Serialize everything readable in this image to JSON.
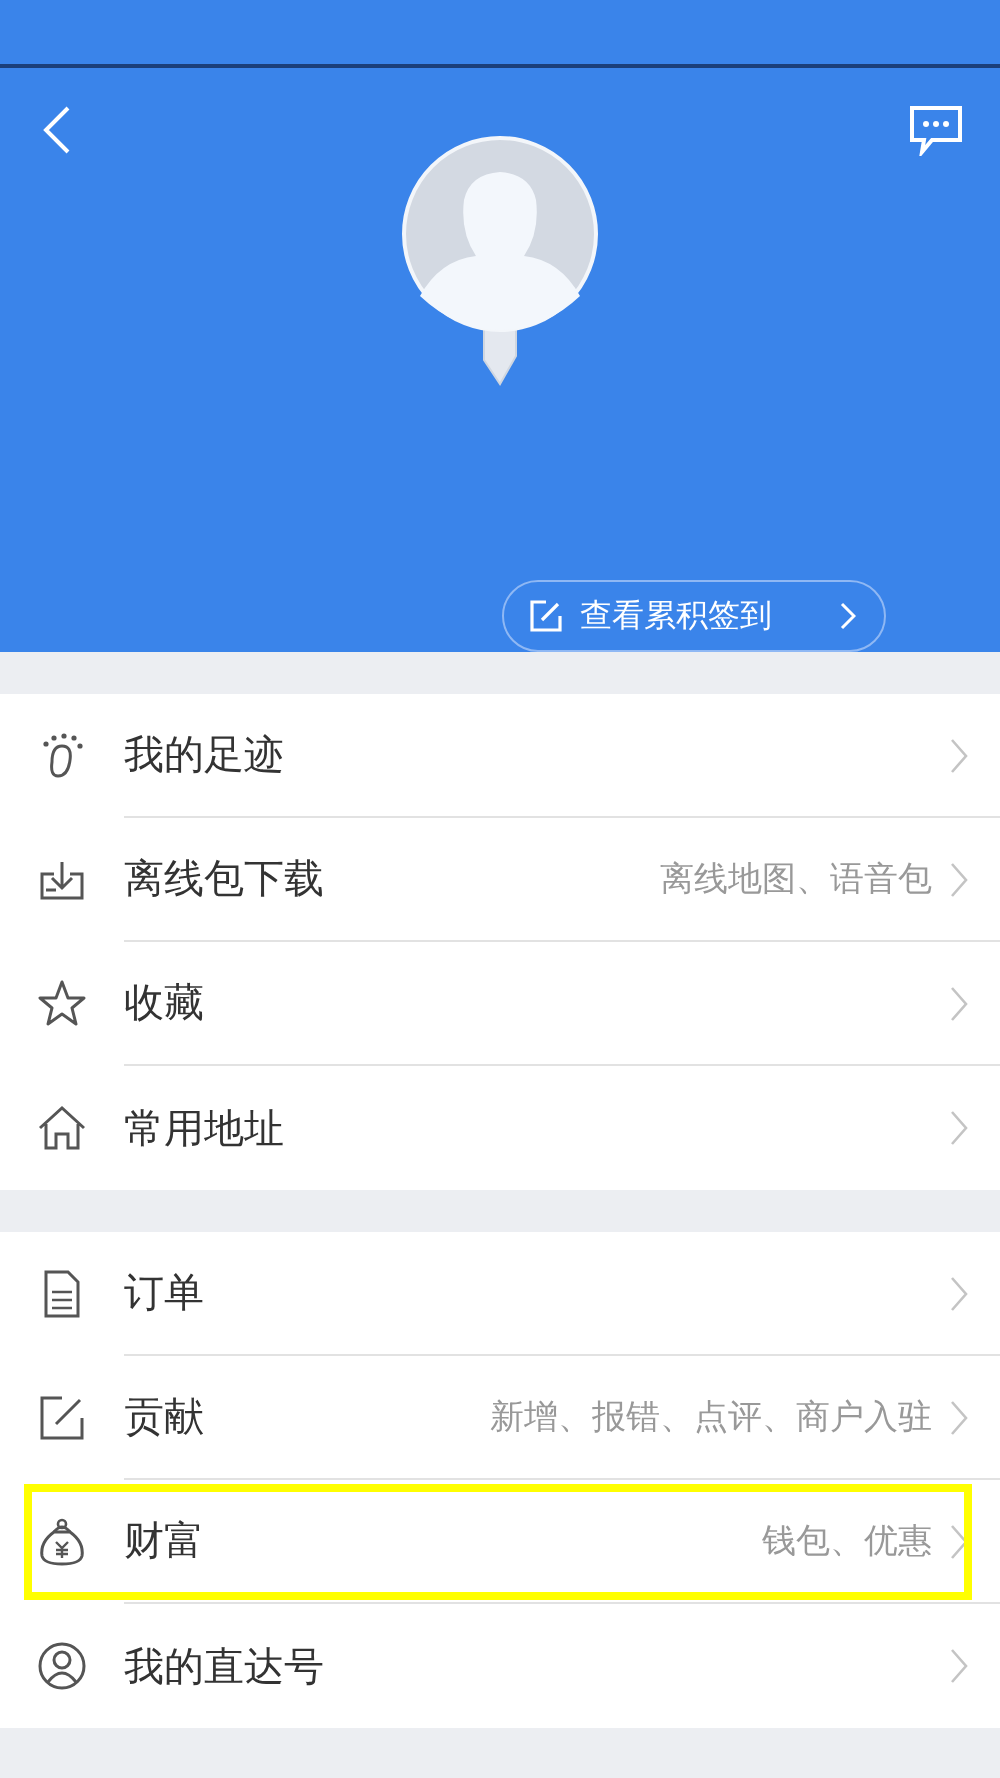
{
  "header": {
    "checkin_button": "查看累积签到"
  },
  "groups": [
    {
      "items": [
        {
          "label": "我的足迹",
          "highlighted": false
        },
        {
          "label": "离线包下载",
          "detail": "离线地图、语音包",
          "highlighted": false
        },
        {
          "label": "收藏",
          "highlighted": false
        },
        {
          "label": "常用地址",
          "highlighted": false
        }
      ]
    },
    {
      "items": [
        {
          "label": "订单",
          "highlighted": false
        },
        {
          "label": "贡献",
          "detail": "新增、报错、点评、商户入驻",
          "highlighted": false
        },
        {
          "label": "财富",
          "detail": "钱包、优惠",
          "highlighted": true
        },
        {
          "label": "我的直达号",
          "highlighted": false
        }
      ]
    }
  ]
}
